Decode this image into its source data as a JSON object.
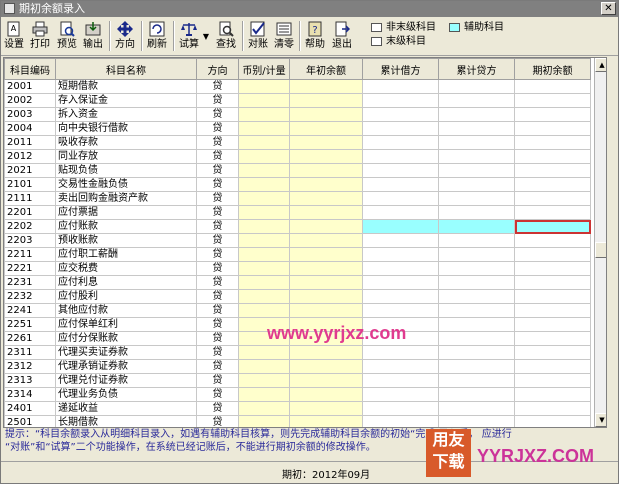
{
  "window": {
    "title": "期初余额录入"
  },
  "toolbar": {
    "buttons": [
      {
        "label": "设置",
        "icon": "settings-icon"
      },
      {
        "label": "打印",
        "icon": "printer-icon"
      },
      {
        "label": "预览",
        "icon": "preview-icon"
      },
      {
        "label": "输出",
        "icon": "export-icon"
      },
      {
        "label": "方向",
        "icon": "direction-icon"
      },
      {
        "label": "刷新",
        "icon": "refresh-icon"
      },
      {
        "label": "试算",
        "icon": "trial-balance-icon"
      },
      {
        "label": "查找",
        "icon": "search-icon"
      },
      {
        "label": "对账",
        "icon": "reconcile-icon"
      },
      {
        "label": "清零",
        "icon": "clear-icon"
      },
      {
        "label": "帮助",
        "icon": "help-icon"
      },
      {
        "label": "退出",
        "icon": "exit-icon"
      }
    ]
  },
  "legend": {
    "non_leaf": "非末级科目",
    "leaf": "末级科目",
    "auxiliary": "辅助科目",
    "colors": {
      "non_leaf": "#ffffff",
      "leaf": "#ffffff",
      "auxiliary": "#99ffff"
    }
  },
  "table": {
    "headers": [
      "科目编码",
      "科目名称",
      "方向",
      "币别/计量",
      "年初余额",
      "累计借方",
      "累计贷方",
      "期初余额"
    ],
    "rows": [
      {
        "code": "2001",
        "name": "短期借款",
        "dir": "贷",
        "aux": false
      },
      {
        "code": "2002",
        "name": "存入保证金",
        "dir": "贷",
        "aux": false
      },
      {
        "code": "2003",
        "name": "拆入资金",
        "dir": "贷",
        "aux": false
      },
      {
        "code": "2004",
        "name": "向中央银行借款",
        "dir": "贷",
        "aux": false
      },
      {
        "code": "2011",
        "name": "吸收存款",
        "dir": "贷",
        "aux": false
      },
      {
        "code": "2012",
        "name": "同业存放",
        "dir": "贷",
        "aux": false
      },
      {
        "code": "2021",
        "name": "贴现负债",
        "dir": "贷",
        "aux": false
      },
      {
        "code": "2101",
        "name": "交易性金融负债",
        "dir": "贷",
        "aux": false
      },
      {
        "code": "2111",
        "name": "卖出回购金融资产款",
        "dir": "贷",
        "aux": false
      },
      {
        "code": "2201",
        "name": "应付票据",
        "dir": "贷",
        "aux": false
      },
      {
        "code": "2202",
        "name": "应付账款",
        "dir": "贷",
        "aux": true
      },
      {
        "code": "2203",
        "name": "预收账款",
        "dir": "贷",
        "aux": false
      },
      {
        "code": "2211",
        "name": "应付职工薪酬",
        "dir": "贷",
        "aux": false
      },
      {
        "code": "2221",
        "name": "应交税费",
        "dir": "贷",
        "aux": false
      },
      {
        "code": "2231",
        "name": "应付利息",
        "dir": "贷",
        "aux": false
      },
      {
        "code": "2232",
        "name": "应付股利",
        "dir": "贷",
        "aux": false
      },
      {
        "code": "2241",
        "name": "其他应付款",
        "dir": "贷",
        "aux": false
      },
      {
        "code": "2251",
        "name": "应付保单红利",
        "dir": "贷",
        "aux": false
      },
      {
        "code": "2261",
        "name": "应付分保账款",
        "dir": "贷",
        "aux": false
      },
      {
        "code": "2311",
        "name": "代理买卖证券款",
        "dir": "贷",
        "aux": false
      },
      {
        "code": "2312",
        "name": "代理承销证券款",
        "dir": "贷",
        "aux": false
      },
      {
        "code": "2313",
        "name": "代理兑付证券款",
        "dir": "贷",
        "aux": false
      },
      {
        "code": "2314",
        "name": "代理业务负债",
        "dir": "贷",
        "aux": false
      },
      {
        "code": "2401",
        "name": "递延收益",
        "dir": "贷",
        "aux": false
      },
      {
        "code": "2501",
        "name": "长期借款",
        "dir": "贷",
        "aux": false
      }
    ]
  },
  "hint": {
    "line1": "提示：“科目余额录入从明细科目录入，如遇有辅助科目核算，则先完成辅助科目余额的初始“完成               录入后，         应进行",
    "line2": "“对账”和“试算”二个功能操作，在系统已经记账后，不能进行期初余额的修改操作。"
  },
  "status": {
    "period": "期初：2012年09月"
  },
  "watermark": {
    "url": "www.yyrjxz.com"
  },
  "logo": {
    "line1": "用友",
    "line2": "下载",
    "text": "YYRJXZ.COM"
  }
}
